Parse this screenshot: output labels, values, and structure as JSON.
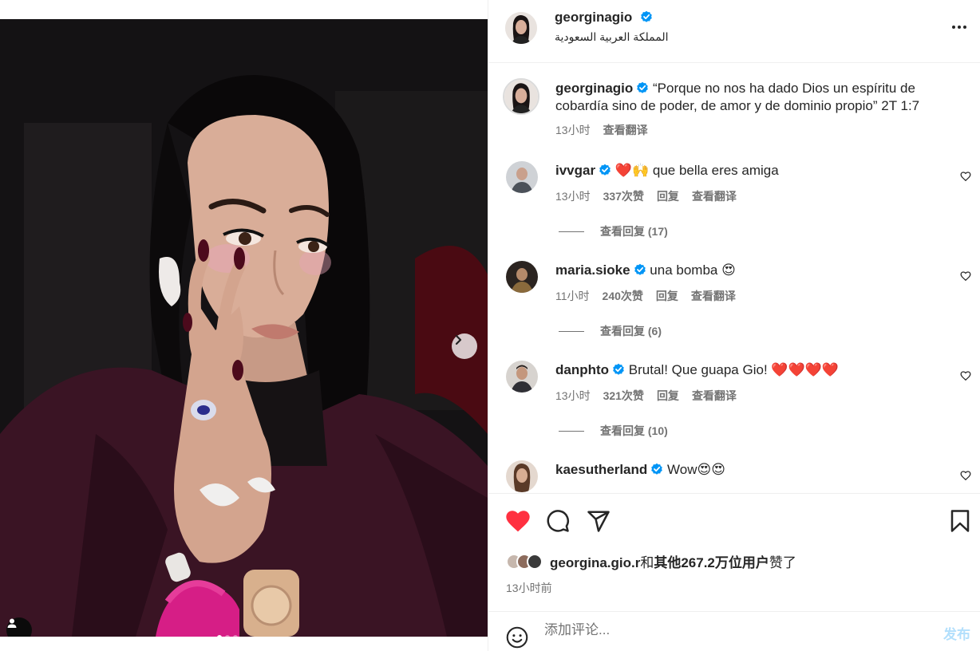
{
  "post": {
    "author": "georginagio",
    "location": "المملكة العربية السعودية",
    "more_label": "···"
  },
  "caption": {
    "username": "georginagio",
    "text": "“Porque no nos ha dado Dios un espíritu de cobardía sino de poder, de amor y de dominio propio” 2T 1:7",
    "time": "13小时",
    "translate": "查看翻译"
  },
  "comments": [
    {
      "username": "ivvgar",
      "text": "❤️🙌 que bella eres amiga",
      "time": "13小时",
      "likes": "337次赞",
      "reply": "回复",
      "translate": "查看翻译",
      "view_replies": "查看回复 (17)"
    },
    {
      "username": "maria.sioke",
      "text": "una bomba 😍",
      "time": "11小时",
      "likes": "240次赞",
      "reply": "回复",
      "translate": "查看翻译",
      "view_replies": "查看回复 (6)"
    },
    {
      "username": "danphto",
      "text": "Brutal! Que guapa Gio! ❤️❤️❤️❤️",
      "time": "13小时",
      "likes": "321次赞",
      "reply": "回复",
      "translate": "查看翻译",
      "view_replies": "查看回复 (10)"
    },
    {
      "username": "kaesutherland",
      "text": "Wow😍😍"
    }
  ],
  "likes": {
    "first_user": "georgina.gio.r",
    "connector": "和",
    "others": "其他267.2万位用户",
    "suffix": "赞了"
  },
  "time_ago": "13小时前",
  "add_comment": {
    "placeholder": "添加评论...",
    "post_label": "发布"
  },
  "carousel": {
    "count": 3,
    "active": 0
  },
  "colors": {
    "like_red": "#ff3040",
    "verified_blue": "#0095f6",
    "post_disabled": "#b2dffc",
    "secondary_text": "#737373"
  },
  "icons": {
    "like": "heart-filled-icon",
    "comment": "comment-bubble-icon",
    "share": "paper-plane-icon",
    "save": "bookmark-icon",
    "emoji": "smiley-icon",
    "next": "chevron-right-icon",
    "tag": "user-tag-icon",
    "more": "more-options-icon"
  }
}
